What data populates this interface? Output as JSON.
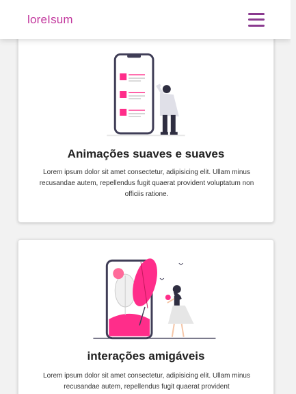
{
  "header": {
    "logo": "loreIsum",
    "menu_icon": "hamburger-menu-icon",
    "accent": "#c2379d",
    "menu_color": "#8a3a8f"
  },
  "cards": [
    {
      "title": "Animações suaves e suaves",
      "text": "Lorem ipsum dolor sit amet consectetur, adipisicing elit. Ullam minus recusandae autem, repellendus fugit quaerat provident voluptatum non officiis ratione.",
      "illustration": "person-with-phone-list-illustration"
    },
    {
      "title": "interações amigáveis",
      "text": "Lorem ipsum dolor sit amet consectetur, adipisicing elit. Ullam minus recusandae autem, repellendus fugit quaerat provident",
      "illustration": "woman-with-phone-plants-illustration"
    }
  ],
  "colors": {
    "pink": "#ff2d8a",
    "dark": "#3f3d56"
  }
}
